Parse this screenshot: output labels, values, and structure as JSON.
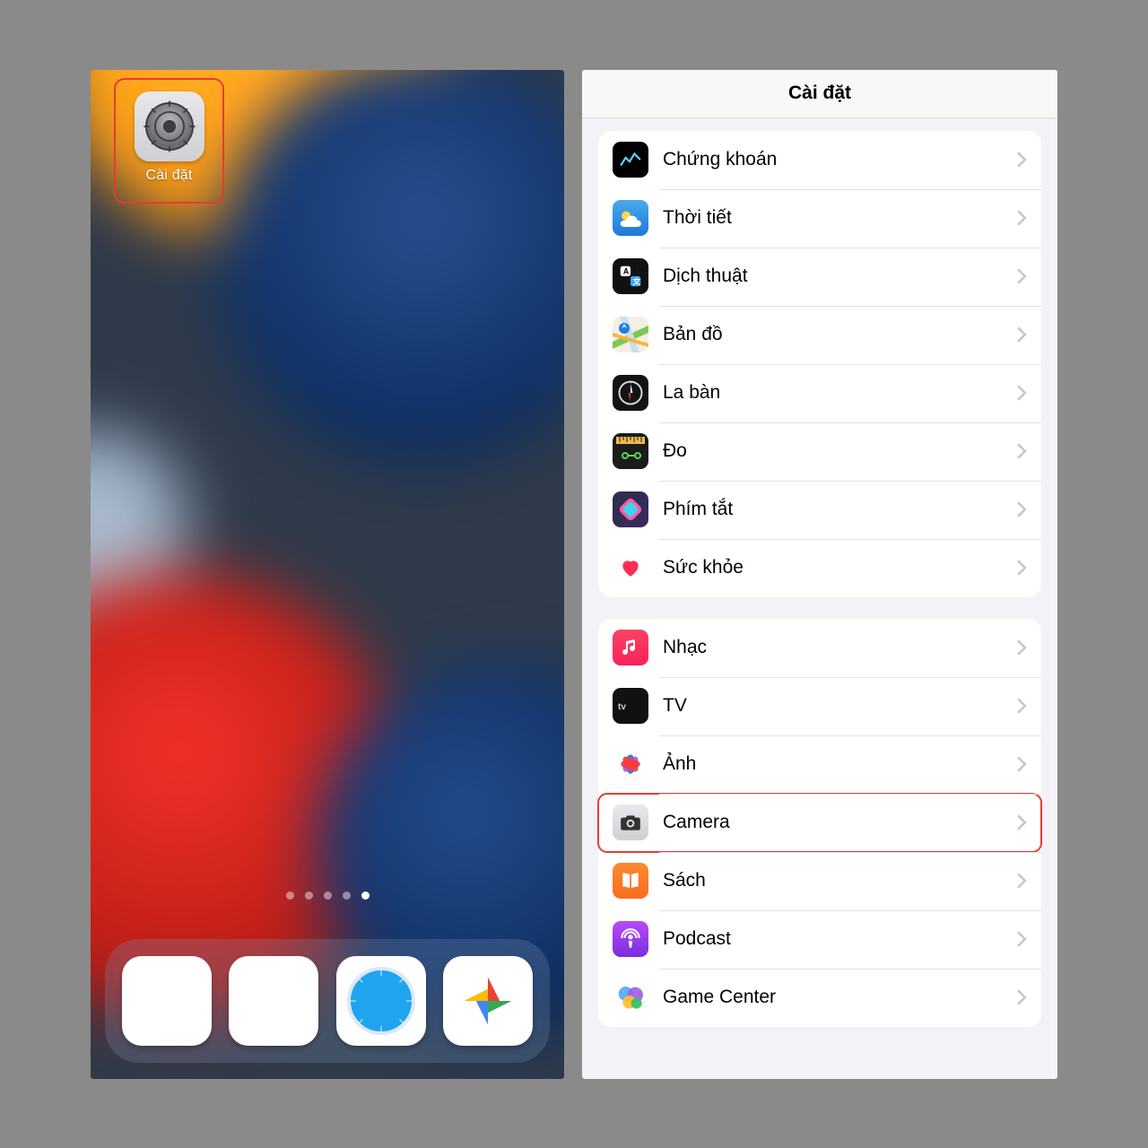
{
  "left": {
    "settings_icon_label": "Cài đặt",
    "highlighted": true,
    "dock": [
      {
        "name": "phone"
      },
      {
        "name": "messages"
      },
      {
        "name": "safari"
      },
      {
        "name": "photos"
      }
    ],
    "page_count": 5,
    "page_index": 4
  },
  "right": {
    "title": "Cài đặt",
    "groups": [
      [
        {
          "key": "stocks",
          "label": "Chứng khoán"
        },
        {
          "key": "weather",
          "label": "Thời tiết"
        },
        {
          "key": "translate",
          "label": "Dịch thuật"
        },
        {
          "key": "maps",
          "label": "Bản đồ"
        },
        {
          "key": "compass",
          "label": "La bàn"
        },
        {
          "key": "measure",
          "label": "Đo"
        },
        {
          "key": "shortcuts",
          "label": "Phím tắt"
        },
        {
          "key": "health",
          "label": "Sức khỏe"
        }
      ],
      [
        {
          "key": "music",
          "label": "Nhạc"
        },
        {
          "key": "tv",
          "label": "TV"
        },
        {
          "key": "photos",
          "label": "Ảnh"
        },
        {
          "key": "camera",
          "label": "Camera",
          "highlight": true
        },
        {
          "key": "books",
          "label": "Sách"
        },
        {
          "key": "podcast",
          "label": "Podcast"
        },
        {
          "key": "gamectr",
          "label": "Game Center"
        }
      ]
    ]
  }
}
